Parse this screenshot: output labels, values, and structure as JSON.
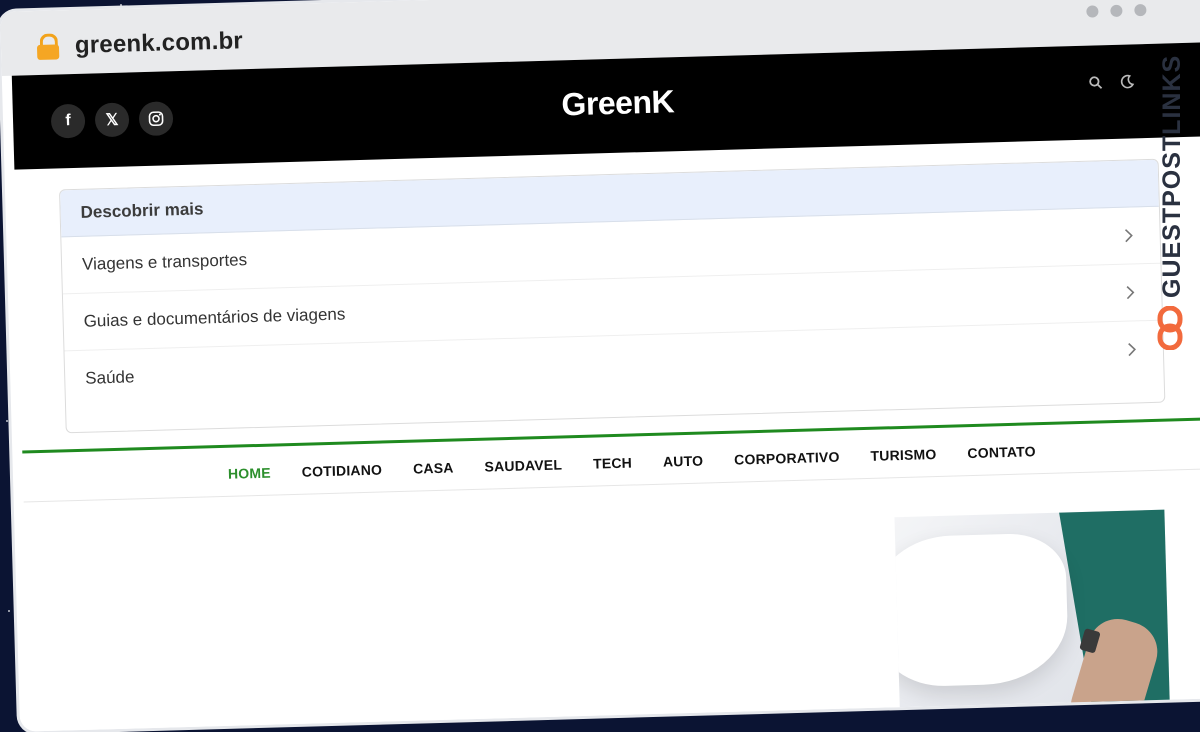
{
  "browser": {
    "domain": "greenk.com.br"
  },
  "header": {
    "logo": "GreenK",
    "socials": [
      {
        "icon": "facebook-icon",
        "glyph": "f"
      },
      {
        "icon": "x-icon",
        "glyph": "𝕏"
      },
      {
        "icon": "instagram-icon",
        "glyph": ""
      }
    ]
  },
  "discover": {
    "title": "Descobrir mais",
    "items": [
      {
        "label": "Viagens e transportes"
      },
      {
        "label": "Guias e documentários de viagens"
      },
      {
        "label": "Saúde"
      }
    ]
  },
  "nav": {
    "items": [
      {
        "label": "HOME",
        "active": true
      },
      {
        "label": "COTIDIANO"
      },
      {
        "label": "CASA"
      },
      {
        "label": "SAUDAVEL"
      },
      {
        "label": "TECH"
      },
      {
        "label": "AUTO"
      },
      {
        "label": "CORPORATIVO"
      },
      {
        "label": "TURISMO"
      },
      {
        "label": "CONTATO"
      }
    ]
  },
  "watermark": {
    "text": "GUESTPOSTLINKS"
  },
  "colors": {
    "accent_green": "#2c8f2c",
    "header_bg": "#000000",
    "discover_header_bg": "#e8effc",
    "lock": "#f5a623",
    "watermark_link": "#f26a3d"
  }
}
